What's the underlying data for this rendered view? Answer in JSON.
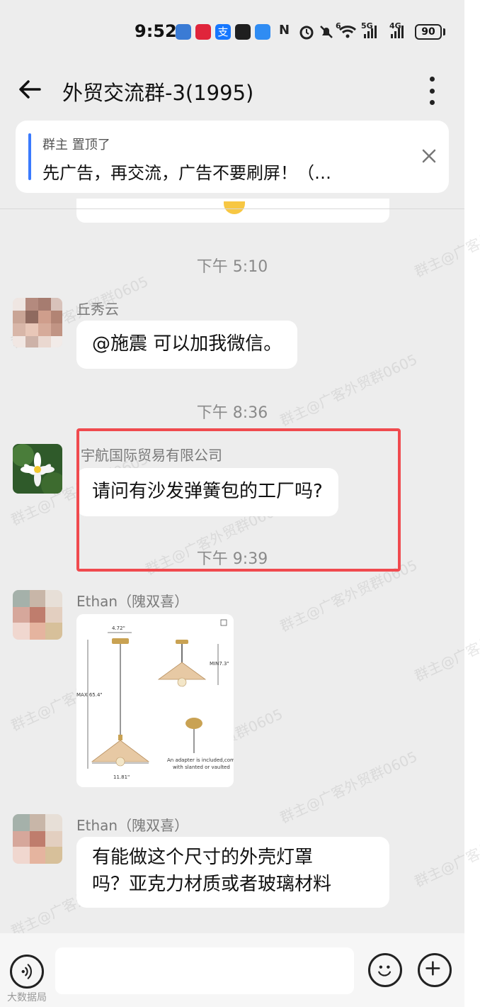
{
  "status_bar": {
    "time": "9:52",
    "network_1": "5G",
    "network_2": "4G",
    "network_3": "6",
    "battery": "90",
    "app_icons": [
      "blue-app-icon",
      "red-app-icon",
      "alipay-icon",
      "game-app-icon",
      "cloud-app-icon"
    ],
    "system_icons": [
      "nfc-icon",
      "alarm-icon",
      "mute-icon",
      "wifi-icon",
      "signal-icon"
    ]
  },
  "header": {
    "title": "外贸交流群-3(1995)"
  },
  "pinned": {
    "meta": "群主 置顶了",
    "text": "先广告，再交流，广告不要刷屏！（…"
  },
  "messages": [
    {
      "type": "time",
      "text": "下午 5:10"
    },
    {
      "type": "text",
      "sender": "丘秀云",
      "text": "@施震 可以加我微信。"
    },
    {
      "type": "time",
      "text": "下午 8:36"
    },
    {
      "type": "text",
      "sender": "宇航国际贸易有限公司",
      "text": "请问有沙发弹簧包的工厂吗?"
    },
    {
      "type": "time",
      "text": "下午 9:39"
    },
    {
      "type": "image",
      "sender": "Ethan（隗双喜）"
    },
    {
      "type": "text",
      "sender": "Ethan（隗双喜）",
      "text_line1": "有能做这个尺寸的外壳灯罩",
      "text_line2": "吗？亚克力材质或者玻璃材料"
    }
  ],
  "product_image": {
    "width_label": "4.72\"",
    "min_label": "MIN7.3\"",
    "max_label": "MAX 65.4\"",
    "bottom_label": "11.81\"",
    "adapter_line1": "An adapter is included,compatible",
    "adapter_line2": "with slanted or vaulted"
  },
  "watermark": "群主@广客外贸群0605",
  "input": {
    "placeholder": ""
  },
  "footer_mark": "大数据局",
  "colors": {
    "background": "#ededed",
    "bubble": "#ffffff",
    "highlight": "#f04a4e",
    "pinned_accent": "#3a7afe"
  }
}
